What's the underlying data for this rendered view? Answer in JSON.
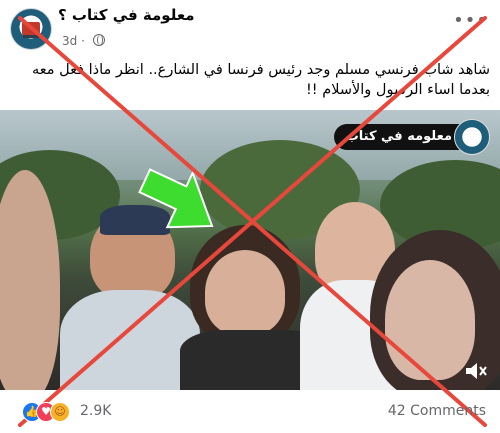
{
  "post": {
    "page_name": "معلومة في كتاب ؟",
    "time": "3d",
    "caption_lines": [
      "شاهد شاب فرنسي مسلم وجد رئيس فرنسا في الشارع.. انظر ماذا فعل معه",
      "بعدما اساء الرسول والأسلام !!"
    ]
  },
  "video": {
    "watermark": "معلومه في كتاب"
  },
  "footer": {
    "reaction_count": "2.9K",
    "comments": "42 Comments"
  },
  "colors": {
    "overlay_x": "#e8473b",
    "arrow": "#3ddc2e",
    "link_gray": "#65676b"
  },
  "icons": [
    "page-avatar-icon",
    "globe-icon",
    "more-icon",
    "like-icon",
    "love-icon",
    "care-icon",
    "mute-icon",
    "arrow-icon"
  ]
}
